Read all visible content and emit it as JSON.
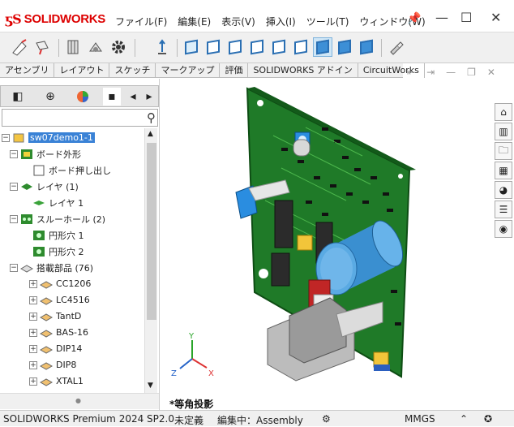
{
  "app": {
    "logo_text": "SOLIDWORKS"
  },
  "menu": [
    "ファイル(F)",
    "編集(E)",
    "表示(V)",
    "挿入(I)",
    "ツール(T)",
    "ウィンドウ(W)"
  ],
  "window_controls": {
    "minimize": "—",
    "maximize": "☐",
    "close": "✕"
  },
  "command_tabs": [
    "アセンブリ",
    "レイアウト",
    "スケッチ",
    "マークアップ",
    "評価",
    "SOLIDWORKS アドイン",
    "CircuitWorks"
  ],
  "tree": {
    "root": "sw07demo1-1",
    "items": [
      {
        "label": "ボード外形",
        "level": 1,
        "expand": "-"
      },
      {
        "label": "ボード押し出し",
        "level": 2,
        "expand": ""
      },
      {
        "label": "レイヤ (1)",
        "level": 1,
        "expand": "-"
      },
      {
        "label": "レイヤ 1",
        "level": 2,
        "expand": ""
      },
      {
        "label": "スルーホール (2)",
        "level": 1,
        "expand": "-"
      },
      {
        "label": "円形穴 1",
        "level": 2,
        "expand": ""
      },
      {
        "label": "円形穴 2",
        "level": 2,
        "expand": ""
      },
      {
        "label": "搭載部品 (76)",
        "level": 1,
        "expand": "-"
      },
      {
        "label": "CC1206",
        "level": 2,
        "expand": "+"
      },
      {
        "label": "LC4516",
        "level": 2,
        "expand": "+"
      },
      {
        "label": "TantD",
        "level": 2,
        "expand": "+"
      },
      {
        "label": "BAS-16",
        "level": 2,
        "expand": "+"
      },
      {
        "label": "DIP14",
        "level": 2,
        "expand": "+"
      },
      {
        "label": "DIP8",
        "level": 2,
        "expand": "+"
      },
      {
        "label": "XTAL1",
        "level": 2,
        "expand": "+"
      }
    ]
  },
  "viewport": {
    "view_name": "*等角投影"
  },
  "status": {
    "product": "SOLIDWORKS Premium 2024 SP2.0",
    "state": "未定義",
    "editing": "編集中：Assembly",
    "units": "MMGS"
  }
}
